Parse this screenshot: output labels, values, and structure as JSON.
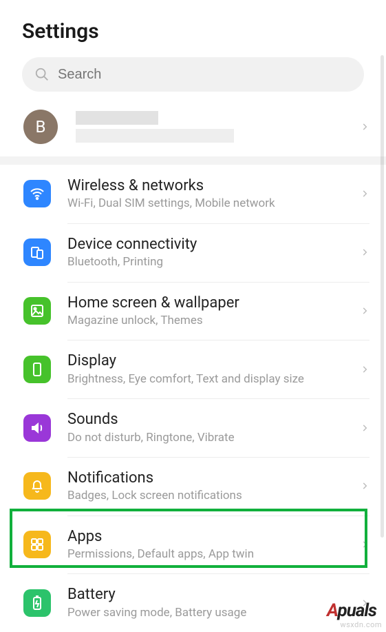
{
  "header": {
    "title": "Settings"
  },
  "search": {
    "placeholder": "Search"
  },
  "account": {
    "avatarInitial": "B"
  },
  "items": [
    {
      "title": "Wireless & networks",
      "sub": "Wi-Fi, Dual SIM settings, Mobile network"
    },
    {
      "title": "Device connectivity",
      "sub": "Bluetooth, Printing"
    },
    {
      "title": "Home screen & wallpaper",
      "sub": "Magazine unlock, Themes"
    },
    {
      "title": "Display",
      "sub": "Brightness, Eye comfort, Text and display size"
    },
    {
      "title": "Sounds",
      "sub": "Do not disturb, Ringtone, Vibrate"
    },
    {
      "title": "Notifications",
      "sub": "Badges, Lock screen notifications"
    },
    {
      "title": "Apps",
      "sub": "Permissions, Default apps, App twin"
    },
    {
      "title": "Battery",
      "sub": "Power saving mode, Battery usage"
    }
  ],
  "brand": {
    "a": "A",
    "rest": "puals"
  },
  "watermark": "wsxdn.com"
}
